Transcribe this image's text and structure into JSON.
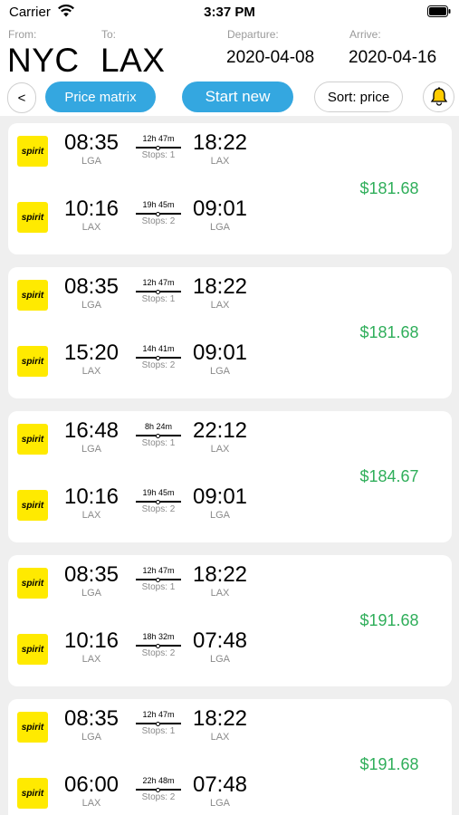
{
  "status_bar": {
    "carrier": "Carrier",
    "time": "3:37 PM"
  },
  "header": {
    "from_label": "From:",
    "from_code": "NYC",
    "to_label": "To:",
    "to_code": "LAX",
    "departure_label": "Departure:",
    "departure_date": "2020-04-08",
    "arrive_label": "Arrive:",
    "arrive_date": "2020-04-16"
  },
  "toolbar": {
    "back_label": "<",
    "price_matrix_label": "Price matrix",
    "start_new_label": "Start new",
    "sort_label": "Sort: price",
    "bell_icon": "bell-icon"
  },
  "colors": {
    "accent": "#34a7e0",
    "price": "#2fae5a",
    "airline_logo": "#ffea00",
    "bell": "#ffcc00"
  },
  "results": [
    {
      "price": "$181.68",
      "legs": [
        {
          "airline": "spirit",
          "depart_time": "08:35",
          "depart_airport": "LGA",
          "duration": "12h 47m",
          "stops": "Stops: 1",
          "arrive_time": "18:22",
          "arrive_airport": "LAX"
        },
        {
          "airline": "spirit",
          "depart_time": "10:16",
          "depart_airport": "LAX",
          "duration": "19h 45m",
          "stops": "Stops: 2",
          "arrive_time": "09:01",
          "arrive_airport": "LGA"
        }
      ]
    },
    {
      "price": "$181.68",
      "legs": [
        {
          "airline": "spirit",
          "depart_time": "08:35",
          "depart_airport": "LGA",
          "duration": "12h 47m",
          "stops": "Stops: 1",
          "arrive_time": "18:22",
          "arrive_airport": "LAX"
        },
        {
          "airline": "spirit",
          "depart_time": "15:20",
          "depart_airport": "LAX",
          "duration": "14h 41m",
          "stops": "Stops: 2",
          "arrive_time": "09:01",
          "arrive_airport": "LGA"
        }
      ]
    },
    {
      "price": "$184.67",
      "legs": [
        {
          "airline": "spirit",
          "depart_time": "16:48",
          "depart_airport": "LGA",
          "duration": "8h 24m",
          "stops": "Stops: 1",
          "arrive_time": "22:12",
          "arrive_airport": "LAX"
        },
        {
          "airline": "spirit",
          "depart_time": "10:16",
          "depart_airport": "LAX",
          "duration": "19h 45m",
          "stops": "Stops: 2",
          "arrive_time": "09:01",
          "arrive_airport": "LGA"
        }
      ]
    },
    {
      "price": "$191.68",
      "legs": [
        {
          "airline": "spirit",
          "depart_time": "08:35",
          "depart_airport": "LGA",
          "duration": "12h 47m",
          "stops": "Stops: 1",
          "arrive_time": "18:22",
          "arrive_airport": "LAX"
        },
        {
          "airline": "spirit",
          "depart_time": "10:16",
          "depart_airport": "LAX",
          "duration": "18h 32m",
          "stops": "Stops: 2",
          "arrive_time": "07:48",
          "arrive_airport": "LGA"
        }
      ]
    },
    {
      "price": "$191.68",
      "legs": [
        {
          "airline": "spirit",
          "depart_time": "08:35",
          "depart_airport": "LGA",
          "duration": "12h 47m",
          "stops": "Stops: 1",
          "arrive_time": "18:22",
          "arrive_airport": "LAX"
        },
        {
          "airline": "spirit",
          "depart_time": "06:00",
          "depart_airport": "LAX",
          "duration": "22h 48m",
          "stops": "Stops: 2",
          "arrive_time": "07:48",
          "arrive_airport": "LGA"
        }
      ]
    }
  ]
}
